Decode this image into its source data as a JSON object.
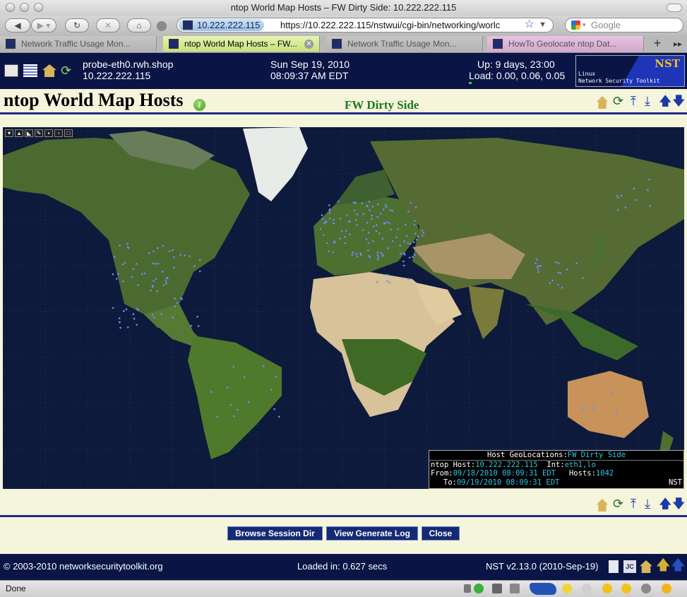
{
  "window": {
    "title": "ntop World Map Hosts – FW Dirty Side: 10.222.222.115"
  },
  "toolbar": {
    "url_host": "10.222.222.115",
    "url": "https://10.222.222.115/nstwui/cgi-bin/networking/worlc",
    "search_placeholder": "Google"
  },
  "tabs": [
    {
      "label": "Network Traffic Usage Mon..."
    },
    {
      "label": "ntop World Map Hosts – FW..."
    },
    {
      "label": "Network Traffic Usage Mon..."
    },
    {
      "label": "HowTo Geolocate ntop Dat..."
    }
  ],
  "nst_header": {
    "probe": "probe-eth0.rwh.shop",
    "ip": "10.222.222.115",
    "date": "Sun Sep 19, 2010",
    "time": "08:09:37 AM EDT",
    "uptime": "Up: 9 days, 23:00",
    "load": "Load: 0.00, 0.06, 0.05",
    "logo_title": "NST",
    "logo_text1": "Linux",
    "logo_text2": "Network Security Toolkit"
  },
  "page": {
    "title": "ntop World Map Hosts",
    "subtitle": "FW Dirty Side"
  },
  "infobox": {
    "heading_label": "Host GeoLocations:",
    "heading_value": "FW Dirty Side",
    "host_label": "ntop Host:",
    "host_value": "10.222.222.115",
    "int_label": "Int:",
    "int_value": "eth1,lo",
    "from_label": "From:",
    "from_value": "09/18/2010 08:09:31 EDT",
    "hosts_label": "Hosts:",
    "hosts_value": "1042",
    "to_label": "To:",
    "to_value": "09/19/2010 08:09:31 EDT",
    "corner": "NST"
  },
  "buttons": {
    "browse": "Browse Session Dir",
    "viewlog": "View Generate Log",
    "close": "Close"
  },
  "footer": {
    "copyright": "©  2003-2010 networksecuritytoolkit.org",
    "loaded": "Loaded in: 0.627 secs",
    "version": "NST v2.13.0 (2010-Sep-19)"
  },
  "statusbar": {
    "text": "Done"
  },
  "colors": {
    "header_bg": "#0a1546",
    "page_bg": "#f5f5dc",
    "ocean": "#0d1a3b",
    "accent_cyan": "#29c6e8",
    "subtitle_green": "#1c7a1c"
  }
}
